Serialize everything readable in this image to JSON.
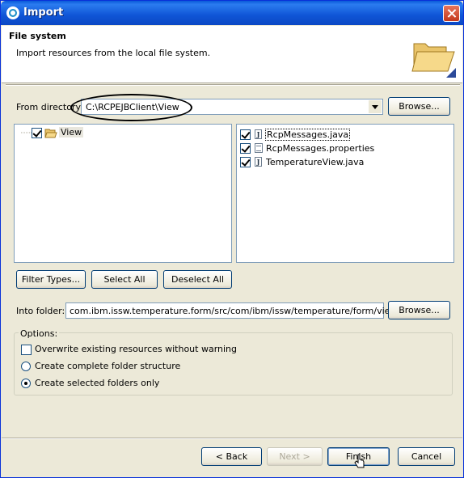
{
  "window": {
    "title": "Import"
  },
  "header": {
    "title": "File system",
    "description": "Import resources from the local file system."
  },
  "from_directory": {
    "label": "From directory:",
    "value": "C:\\RCPEJBClient\\View",
    "browse_label": "Browse..."
  },
  "folder_tree": {
    "items": [
      {
        "label": "View",
        "checked": true
      }
    ]
  },
  "file_list": {
    "items": [
      {
        "label": "RcpMessages.java",
        "checked": true,
        "icon": "java-file-icon"
      },
      {
        "label": "RcpMessages.properties",
        "checked": true,
        "icon": "properties-file-icon"
      },
      {
        "label": "TemperatureView.java",
        "checked": true,
        "icon": "java-file-icon"
      }
    ]
  },
  "selection_buttons": {
    "filter_types": "Filter Types...",
    "select_all": "Select All",
    "deselect_all": "Deselect All"
  },
  "into_folder": {
    "label": "Into folder:",
    "value": "com.ibm.issw.temperature.form/src/com/ibm/issw/temperature/form/views",
    "browse_label": "Browse..."
  },
  "options": {
    "label": "Options:",
    "overwrite": {
      "label": "Overwrite existing resources without warning",
      "checked": false
    },
    "complete_structure": {
      "label": "Create complete folder structure",
      "selected": false
    },
    "selected_only": {
      "label": "Create selected folders only",
      "selected": true
    }
  },
  "footer": {
    "back": "< Back",
    "next": "Next >",
    "finish": "Finish",
    "cancel": "Cancel"
  },
  "colors": {
    "titlebar": "#0a5ad8",
    "dialog_bg": "#ece9d8",
    "field_border": "#7f9db9"
  }
}
